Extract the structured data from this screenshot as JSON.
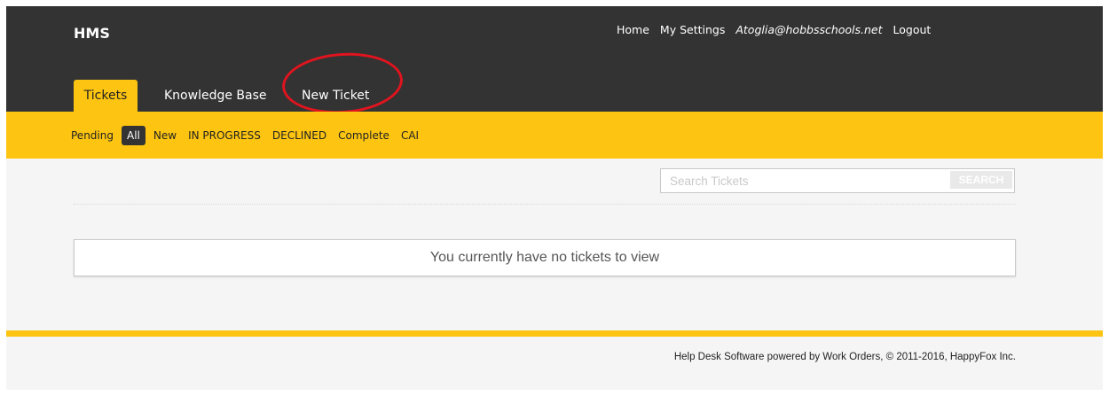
{
  "header": {
    "brand": "HMS",
    "nav": {
      "home": "Home",
      "settings": "My Settings",
      "email": "Atoglia@hobbsschools.net",
      "logout": "Logout"
    }
  },
  "tabs": [
    {
      "label": "Tickets",
      "active": true
    },
    {
      "label": "Knowledge Base",
      "active": false
    },
    {
      "label": "New Ticket",
      "active": false
    }
  ],
  "subnav": [
    {
      "label": "Pending",
      "active": false
    },
    {
      "label": "All",
      "active": true
    },
    {
      "label": "New",
      "active": false
    },
    {
      "label": "IN PROGRESS",
      "active": false
    },
    {
      "label": "DECLINED",
      "active": false
    },
    {
      "label": "Complete",
      "active": false
    },
    {
      "label": "CAI",
      "active": false
    }
  ],
  "search": {
    "placeholder": "Search Tickets",
    "value": "",
    "button_label": "SEARCH"
  },
  "empty_message": "You currently have no tickets to view",
  "footer": {
    "link": "Help Desk Software",
    "text": " powered by Work Orders, © 2011-2016, HappyFox Inc."
  },
  "colors": {
    "header_bg": "#333333",
    "accent": "#fdc511",
    "annotation": "#e0141e"
  }
}
